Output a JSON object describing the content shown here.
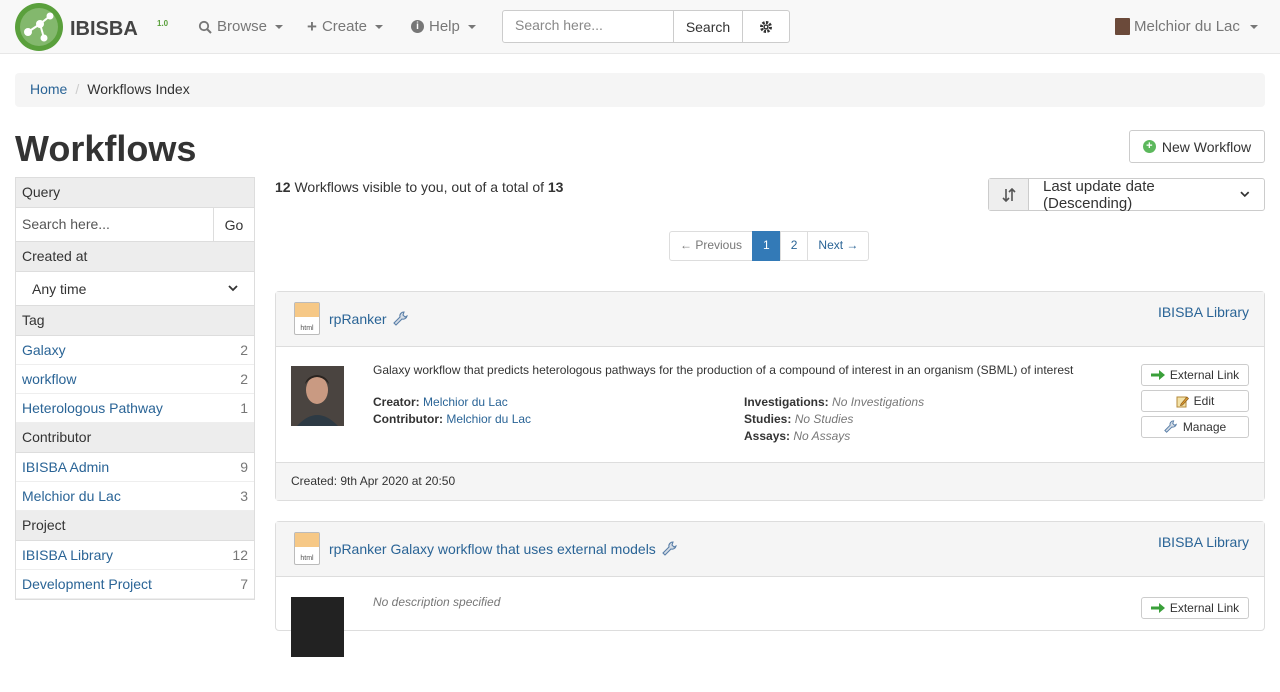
{
  "nav": {
    "brand": "IBISBA",
    "version": "1.0",
    "browse": "Browse",
    "create": "Create",
    "help": "Help",
    "search_placeholder": "Search here...",
    "search_button": "Search",
    "user": "Melchior du Lac"
  },
  "breadcrumb": {
    "home": "Home",
    "current": "Workflows Index"
  },
  "page_title": "Workflows",
  "new_button": "New Workflow",
  "sidebar": {
    "query_header": "Query",
    "query_placeholder": "Search here...",
    "go": "Go",
    "created_header": "Created at",
    "created_value": "Any time",
    "tag_header": "Tag",
    "tags": [
      {
        "label": "Galaxy",
        "count": "2"
      },
      {
        "label": "workflow",
        "count": "2"
      },
      {
        "label": "Heterologous Pathway",
        "count": "1"
      }
    ],
    "contributor_header": "Contributor",
    "contributors": [
      {
        "label": "IBISBA Admin",
        "count": "9"
      },
      {
        "label": "Melchior du Lac",
        "count": "3"
      }
    ],
    "project_header": "Project",
    "projects": [
      {
        "label": "IBISBA Library",
        "count": "12"
      },
      {
        "label": "Development Project",
        "count": "7"
      }
    ]
  },
  "summary": {
    "visible": "12",
    "mid": " Workflows visible to you, out of a total of ",
    "total": "13"
  },
  "sort": {
    "value": "Last update date (Descending)"
  },
  "pager": {
    "prev": "← Previous",
    "p1": "1",
    "p2": "2",
    "next": "Next →"
  },
  "cards": [
    {
      "title": "rpRanker",
      "project": "IBISBA Library",
      "file_ext": "html",
      "description": "Galaxy workflow that predicts heterologous pathways for the production of a compound of interest in an organism (SBML) of interest",
      "creator_label": "Creator:",
      "creator": "Melchior du Lac",
      "contributor_label": "Contributor:",
      "contributor": "Melchior du Lac",
      "inv_label": "Investigations:",
      "inv": "No Investigations",
      "studies_label": "Studies:",
      "studies": "No Studies",
      "assays_label": "Assays:",
      "assays": "No Assays",
      "btn_external": "External Link",
      "btn_edit": "Edit",
      "btn_manage": "Manage",
      "created": "Created: 9th Apr 2020 at 20:50"
    },
    {
      "title": "rpRanker Galaxy workflow that uses external models",
      "project": "IBISBA Library",
      "file_ext": "html",
      "description": "No description specified",
      "btn_external": "External Link"
    }
  ]
}
